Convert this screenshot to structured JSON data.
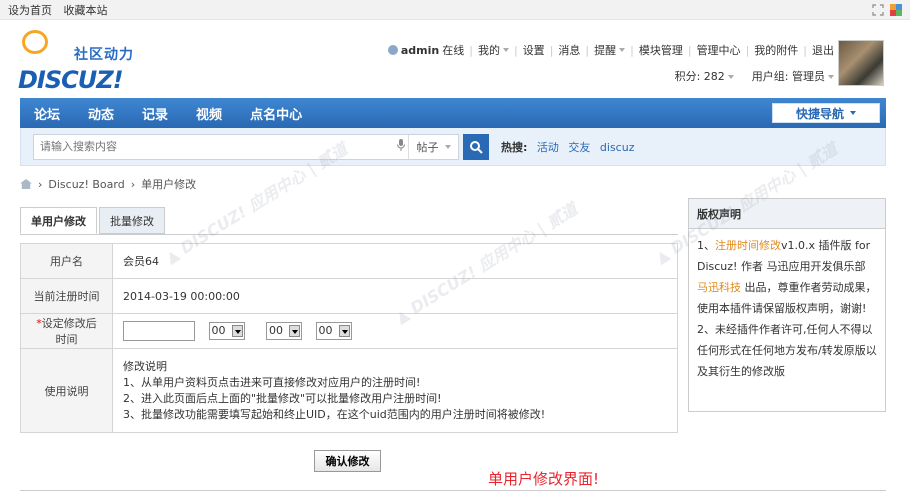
{
  "topbar": {
    "set_home": "设为首页",
    "bookmark": "收藏本站"
  },
  "logo": {
    "cn": "社区动力",
    "en": "DISCUZ!"
  },
  "user": {
    "name": "admin",
    "online": "在线",
    "menu": [
      "我的",
      "设置",
      "消息",
      "提醒",
      "模块管理",
      "管理中心",
      "我的附件",
      "退出"
    ],
    "points": "积分: 282",
    "group": "用户组: 管理员"
  },
  "nav": {
    "items": [
      "论坛",
      "动态",
      "记录",
      "视频",
      "点名中心"
    ],
    "quick": "快捷导航"
  },
  "search": {
    "placeholder": "请输入搜索内容",
    "type": "帖子",
    "hot_label": "热搜:",
    "hot": [
      "活动",
      "交友",
      "discuz"
    ]
  },
  "breadcrumb": {
    "board": "Discuz! Board",
    "page": "单用户修改"
  },
  "tabs": [
    "单用户修改",
    "批量修改"
  ],
  "form": {
    "username_label": "用户名",
    "username_value": "会员64",
    "regtime_label": "当前注册时间",
    "regtime_value": "2014-03-19 00:00:00",
    "set_label_star": "*",
    "set_label": "设定修改后时间",
    "selects": [
      "00",
      "00",
      "00"
    ],
    "usage_label": "使用说明",
    "usage_lines": [
      "修改说明",
      "1、从单用户资料页点击进来可直接修改对应用户的注册时间!",
      "2、进入此页面后点上面的\"批量修改\"可以批量修改用户注册时间!",
      "3、批量修改功能需要填写起始和终止UID，在这个uid范围内的用户注册时间将被修改!"
    ]
  },
  "side": {
    "title": "版权声明",
    "p1_pre": "1、",
    "p1_plugin": "注册时间修改",
    "p1_mid": "v1.0.x 插件版 for Discuz! 作者 马迅应用开发俱乐部 ",
    "p1_author": "马迅科技",
    "p1_post": " 出品，尊重作者劳动成果，使用本插件请保留版权声明，谢谢!",
    "p2": "2、未经插件作者许可,任何人不得以任何形式在任何地方发布/转发原版以及其衍生的修改版"
  },
  "confirm_button": "确认修改",
  "note": "单用户修改界面!",
  "colors": {
    "nav": "#2a69b4",
    "note": "#e8242e",
    "accent": "#e08a1e"
  }
}
